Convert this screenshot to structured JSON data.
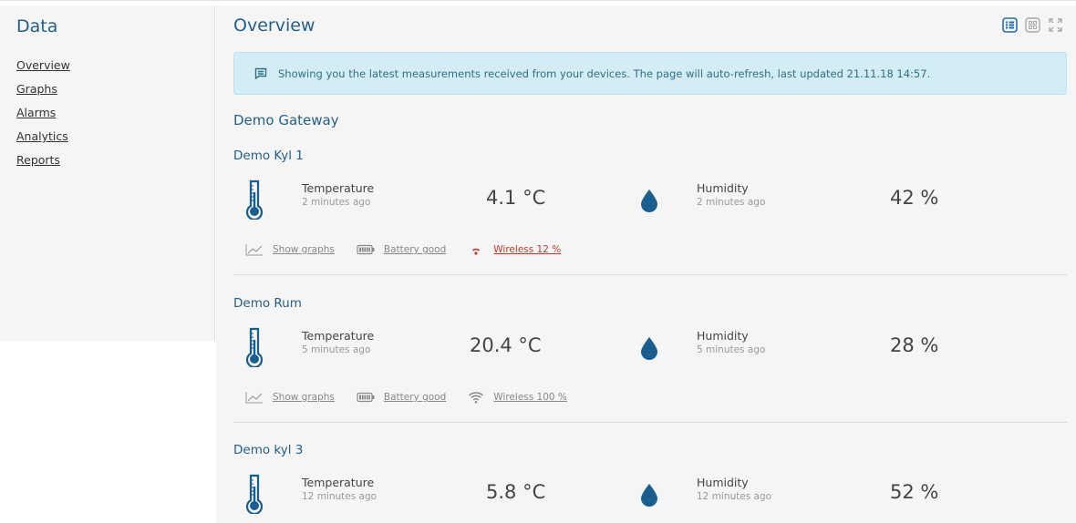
{
  "sidebar": {
    "title": "Data",
    "items": [
      {
        "label": "Overview"
      },
      {
        "label": "Graphs"
      },
      {
        "label": "Alarms"
      },
      {
        "label": "Analytics"
      },
      {
        "label": "Reports"
      }
    ]
  },
  "header": {
    "title": "Overview",
    "view_icons": [
      "list-view-icon",
      "grid-view-icon",
      "fullscreen-icon"
    ],
    "active_view_color": "#1f6fb2"
  },
  "info": {
    "icon": "message-icon",
    "text": "Showing you the latest measurements received from your devices. The page will auto-refresh, last updated 21.11.18 14:57."
  },
  "gateway": {
    "name": "Demo Gateway"
  },
  "devices": [
    {
      "name": "Demo Kyl 1",
      "temperature": {
        "label": "Temperature",
        "time": "2 minutes ago",
        "value": "4.1 °C"
      },
      "humidity": {
        "label": "Humidity",
        "time": "2 minutes ago",
        "value": "42 %"
      },
      "links": {
        "graphs": "Show graphs",
        "battery": "Battery good",
        "wireless": "Wireless 12 %"
      },
      "wireless_status": "weak",
      "wireless_color": "#c0392b"
    },
    {
      "name": "Demo Rum",
      "temperature": {
        "label": "Temperature",
        "time": "5 minutes ago",
        "value": "20.4 °C"
      },
      "humidity": {
        "label": "Humidity",
        "time": "5 minutes ago",
        "value": "28 %"
      },
      "links": {
        "graphs": "Show graphs",
        "battery": "Battery good",
        "wireless": "Wireless 100 %"
      },
      "wireless_status": "full",
      "wireless_color": "#888888"
    },
    {
      "name": "Demo kyl 3",
      "temperature": {
        "label": "Temperature",
        "time": "12 minutes ago",
        "value": "5.8 °C"
      },
      "humidity": {
        "label": "Humidity",
        "time": "12 minutes ago",
        "value": "52 %"
      }
    }
  ],
  "colors": {
    "brand": "#22608f",
    "icon": "#1a5e8f",
    "info_bg": "#d4edf4"
  }
}
